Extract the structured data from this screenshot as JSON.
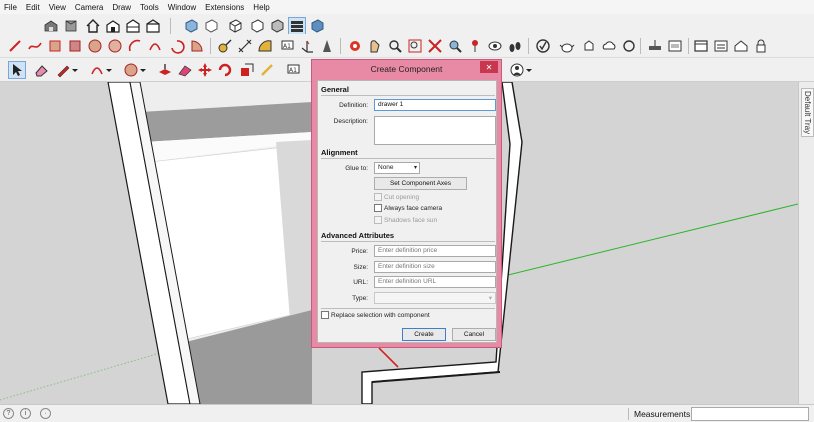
{
  "menu": [
    "File",
    "Edit",
    "View",
    "Camera",
    "Draw",
    "Tools",
    "Window",
    "Extensions",
    "Help"
  ],
  "toolbar_row1": [
    "warehouse-icon",
    "views-icon",
    "home-icon",
    "front-view-icon",
    "back-view-icon",
    "iso-view-icon",
    "top-view-icon",
    "right-view-icon",
    "left-view-icon",
    "bottom-view-icon",
    "shaded-style-icon",
    "textured-style-icon"
  ],
  "toolbar_row2_count": 30,
  "toolbar_row3_count": 14,
  "colors": {
    "dialog_frame": "#e88aa6",
    "close_button": "#c7384e",
    "viewport_bg": "#d4d4d4",
    "green_axis": "#2bb52b",
    "red_axis": "#d62020"
  },
  "tray": {
    "label": "Default Tray"
  },
  "status": {
    "measurements_label": "Measurements",
    "measurements_value": ""
  },
  "dialog": {
    "title": "Create Component",
    "close": "✕",
    "general_header": "General",
    "definition_label": "Definition:",
    "definition_value": "drawer 1",
    "description_label": "Description:",
    "description_value": "",
    "alignment_header": "Alignment",
    "glue_label": "Glue to:",
    "glue_value": "None",
    "set_axes_button": "Set Component Axes",
    "cut_opening": "Cut opening",
    "always_face_camera": "Always face camera",
    "shadows_face_sun": "Shadows face sun",
    "advanced_header": "Advanced Attributes",
    "price_label": "Price:",
    "price_placeholder": "Enter definition price",
    "size_label": "Size:",
    "size_placeholder": "Enter definition size",
    "url_label": "URL:",
    "url_placeholder": "Enter definition URL",
    "type_label": "Type:",
    "type_value": "",
    "replace_selection": "Replace selection with component",
    "create_button": "Create",
    "cancel_button": "Cancel"
  }
}
